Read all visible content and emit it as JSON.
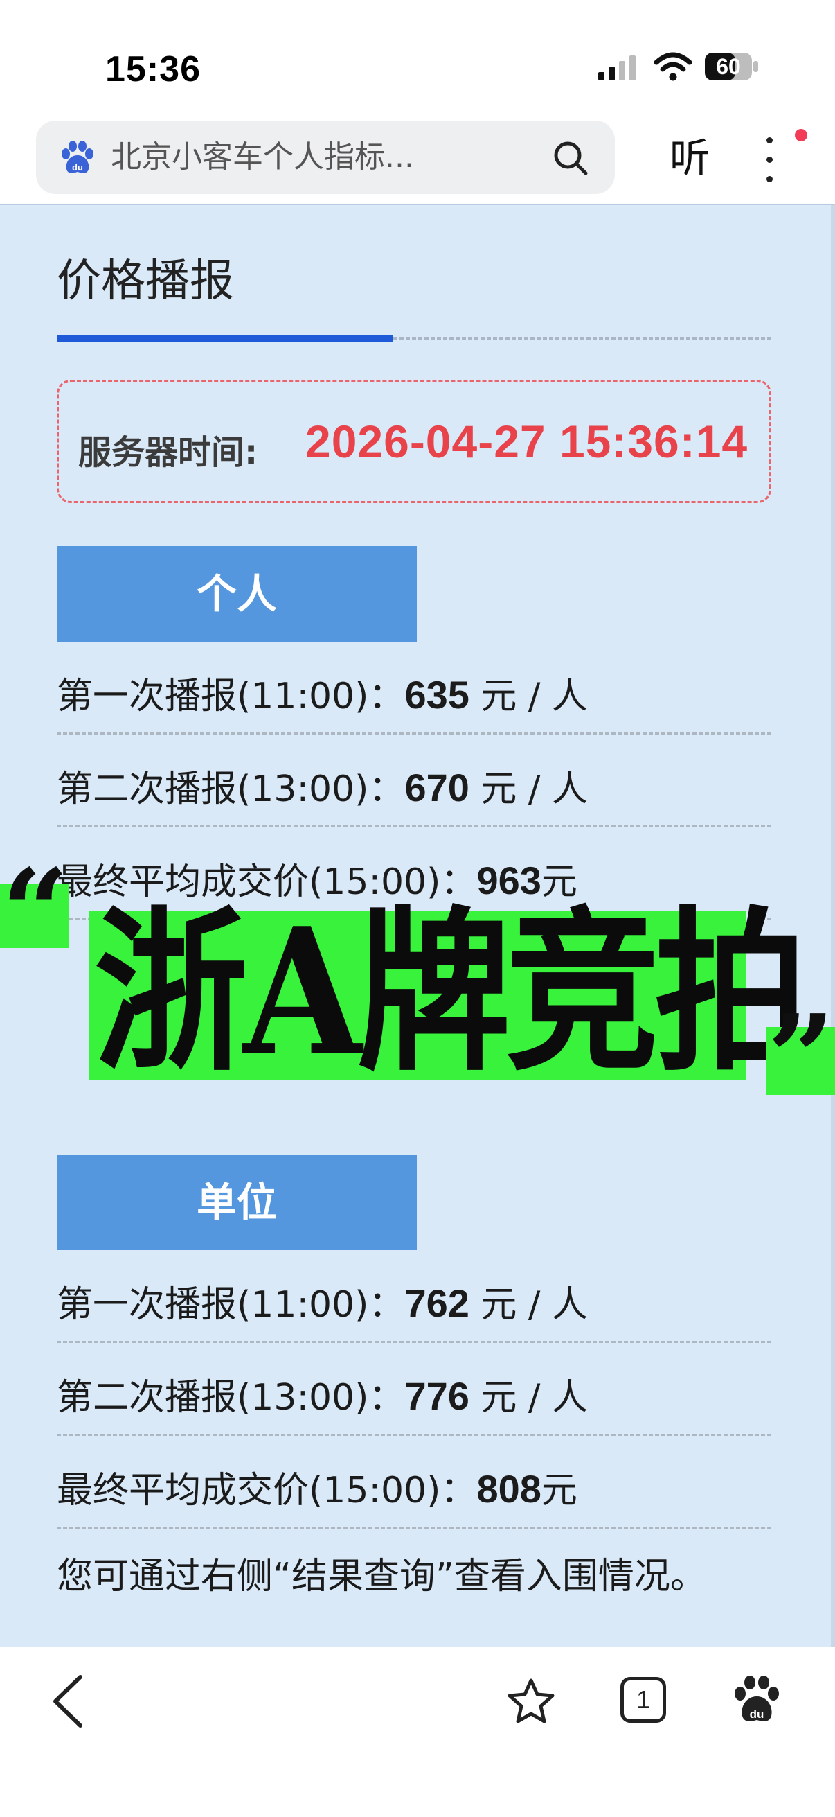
{
  "status_bar": {
    "time": "15:36",
    "battery": "60"
  },
  "browser": {
    "search_text": "北京小客车个人指标...",
    "listen_label": "听"
  },
  "page": {
    "title": "价格播报",
    "server_time_label": "服务器时间:",
    "server_time_value": "2026-04-27 15:36:14",
    "sections": [
      {
        "header": "个人",
        "rows": [
          {
            "prefix": "第一次播报(11:00)：",
            "value": "635",
            "suffix": " 元 / 人"
          },
          {
            "prefix": "第二次播报(13:00)：",
            "value": "670",
            "suffix": " 元 / 人"
          },
          {
            "prefix": "最终平均成交价(15:00)：",
            "value": "963",
            "suffix": "元"
          }
        ]
      },
      {
        "header": "单位",
        "rows": [
          {
            "prefix": "第一次播报(11:00)：",
            "value": "762",
            "suffix": " 元 / 人"
          },
          {
            "prefix": "第二次播报(13:00)：",
            "value": "776",
            "suffix": " 元 / 人"
          },
          {
            "prefix": "最终平均成交价(15:00)：",
            "value": "808",
            "suffix": "元"
          }
        ]
      }
    ],
    "note": "您可通过右侧“结果查询”查看入围情况。"
  },
  "overlay": {
    "quote_open": "“",
    "banner_text": "浙A牌竞拍",
    "quote_close": "”",
    "color": "#38f23b"
  },
  "toolbar": {
    "tab_count": "1"
  },
  "colors": {
    "accent_blue": "#1f5bd8",
    "section_blue": "#5497de",
    "server_time_red": "#e8434a",
    "content_bg": "#d9e9f8"
  }
}
